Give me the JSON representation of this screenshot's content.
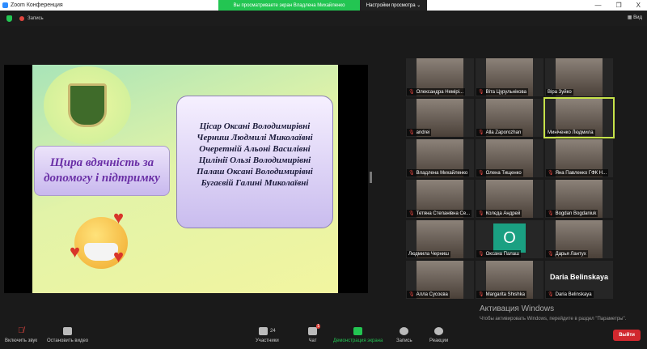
{
  "window": {
    "title": "Zoom Конференция",
    "minimize": "—",
    "restore": "❐",
    "close": "X"
  },
  "banner": {
    "text": "Вы просматриваете экран Владлена Михайленко",
    "view_options": "Настройки просмотра ⌄"
  },
  "topbar": {
    "recording": "Запись",
    "view": "Вид"
  },
  "slide": {
    "thanks": "Щира вдячність за допомогу і підтримку",
    "names": [
      "Цісар Оксані Володимирівні",
      "Черниш Людмилі Миколаївні",
      "Очеретній Альоні Василівні",
      "Цилінії Ользі Володимирівні",
      "Палаш Оксані Володимирівні",
      "Бугаєвій Галині Миколаївні"
    ]
  },
  "participants": [
    {
      "name": "Олександра Немірі...",
      "muted": true
    },
    {
      "name": "Віта Цурульнікова",
      "muted": true
    },
    {
      "name": "Віра Зуйко",
      "muted": false
    },
    {
      "name": "andrei",
      "muted": true
    },
    {
      "name": "Alla Zaporozhan",
      "muted": true
    },
    {
      "name": "Миніченко Людмила",
      "muted": false,
      "active": true
    },
    {
      "name": "Владлена Михайленко",
      "muted": true
    },
    {
      "name": "Олена Тищенко",
      "muted": true
    },
    {
      "name": "Яна Павленко ГФК Н...",
      "muted": true
    },
    {
      "name": "Тетяна Степанівна Се...",
      "muted": true
    },
    {
      "name": "Колєда Андрей",
      "muted": true
    },
    {
      "name": "Bogdan Bogdaniuk",
      "muted": true
    },
    {
      "name": "Людмила Черниш",
      "muted": false
    },
    {
      "name": "Оксана Палаш",
      "muted": true,
      "avatar": "O"
    },
    {
      "name": "Дарья Лантух",
      "muted": true
    },
    {
      "name": "Алла Сусоєва",
      "muted": true
    },
    {
      "name": "Margarita Shishka",
      "muted": true
    },
    {
      "name": "Daria Belinskaya",
      "muted": true,
      "big_name": "Daria Belinskaya"
    }
  ],
  "watermark": {
    "title": "Активация Windows",
    "text": "Чтобы активировать Windows, перейдите в раздел \"Параметры\"."
  },
  "toolbar": {
    "unmute": "Включить звук",
    "stop_video": "Остановить видео",
    "participants": "Участники",
    "participants_count": "24",
    "chat": "Чат",
    "chat_badge": "1",
    "share": "Демонстрация экрана",
    "record": "Запись",
    "reactions": "Реакции",
    "leave": "Выйти"
  },
  "colors": {
    "green": "#23c552",
    "leave": "#d1282e",
    "active_speaker": "#c6e34a"
  }
}
